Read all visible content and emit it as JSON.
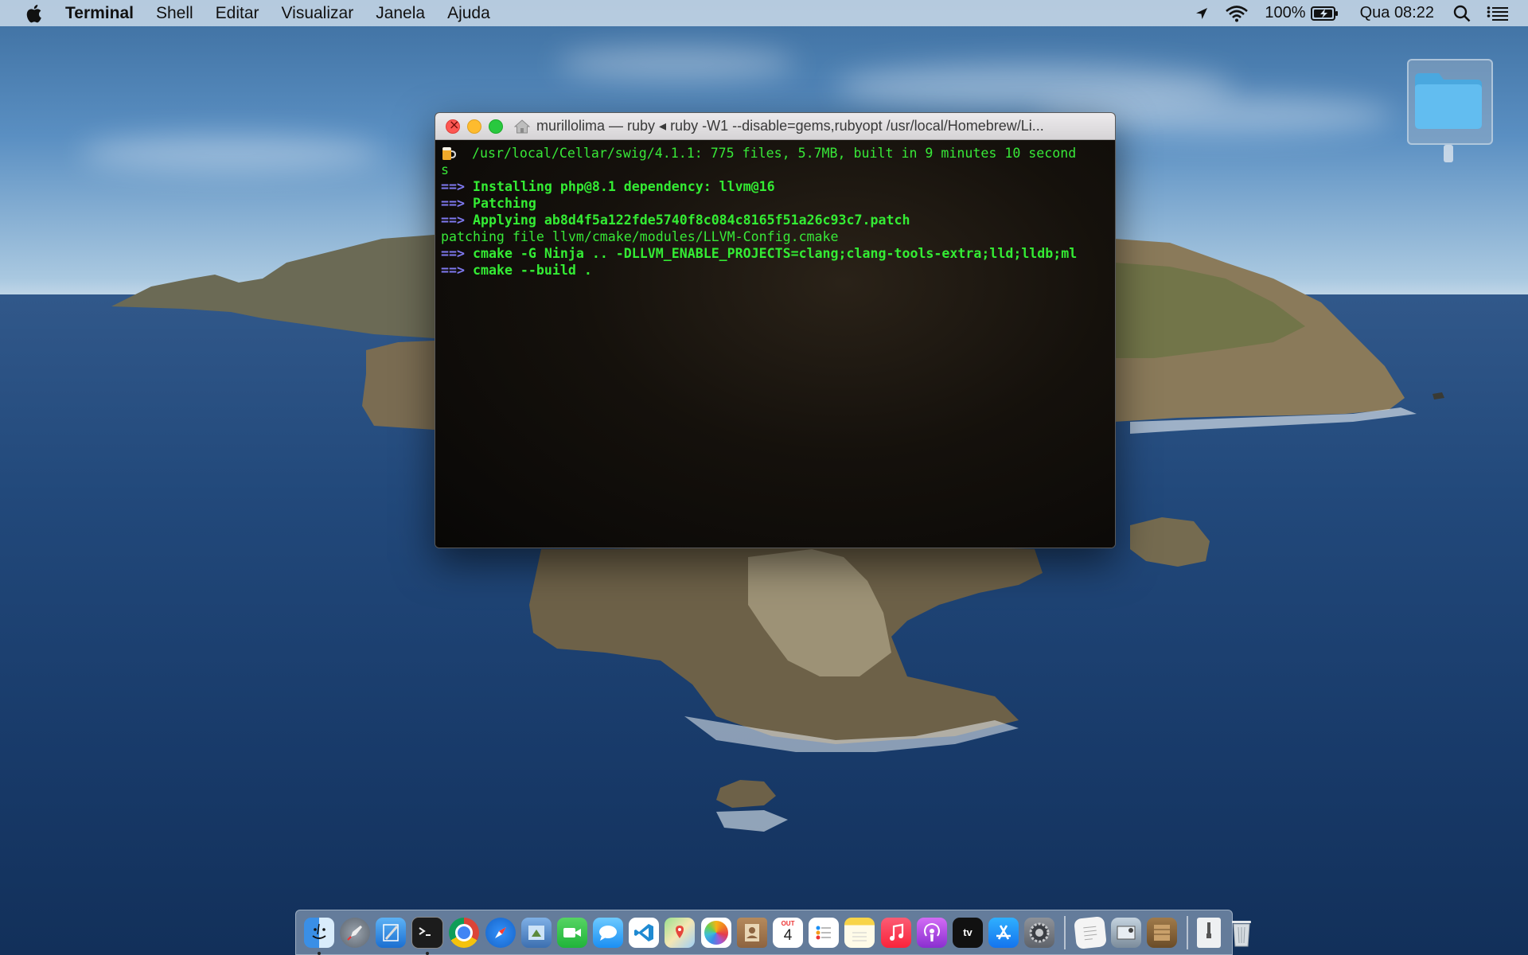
{
  "menubar": {
    "app_name": "Terminal",
    "menus": [
      "Shell",
      "Editar",
      "Visualizar",
      "Janela",
      "Ajuda"
    ],
    "battery": "100%",
    "clock": "Qua 08:22"
  },
  "terminal": {
    "title": "murillolima — ruby ◂ ruby -W1 --disable=gems,rubyopt /usr/local/Homebrew/Li...",
    "lines": {
      "l1": "/usr/local/Cellar/swig/4.1.1: 775 files, 5.7MB, built in 9 minutes 10 second",
      "l1b": "s",
      "arrow": "==>",
      "l2": "Installing php@8.1 dependency: llvm@16",
      "l3": "Patching",
      "l4": "Applying ab8d4f5a122fde5740f8c084c8165f51a26c93c7.patch",
      "l5": "patching file llvm/cmake/modules/LLVM-Config.cmake",
      "l6": "cmake -G Ninja .. -DLLVM_ENABLE_PROJECTS=clang;clang-tools-extra;lld;lldb;ml",
      "l7": "cmake --build ."
    }
  },
  "dock": {
    "apps": [
      "finder",
      "launchpad",
      "xcode",
      "terminal",
      "chrome",
      "safari",
      "preview",
      "facetime",
      "messages",
      "vscode",
      "maps",
      "photos",
      "contacts",
      "calendar",
      "reminders",
      "notes",
      "music",
      "podcasts",
      "tv",
      "app-store",
      "system-preferences",
      "textedit",
      "screenshot",
      "archive",
      "zip",
      "trash"
    ],
    "calendar_day": "4",
    "calendar_month": "OUT",
    "tv_label": "tv"
  },
  "colors": {
    "terminal_green": "#34ec34",
    "terminal_arrow": "#7f79f0",
    "terminal_bg": "#0d0b09"
  }
}
